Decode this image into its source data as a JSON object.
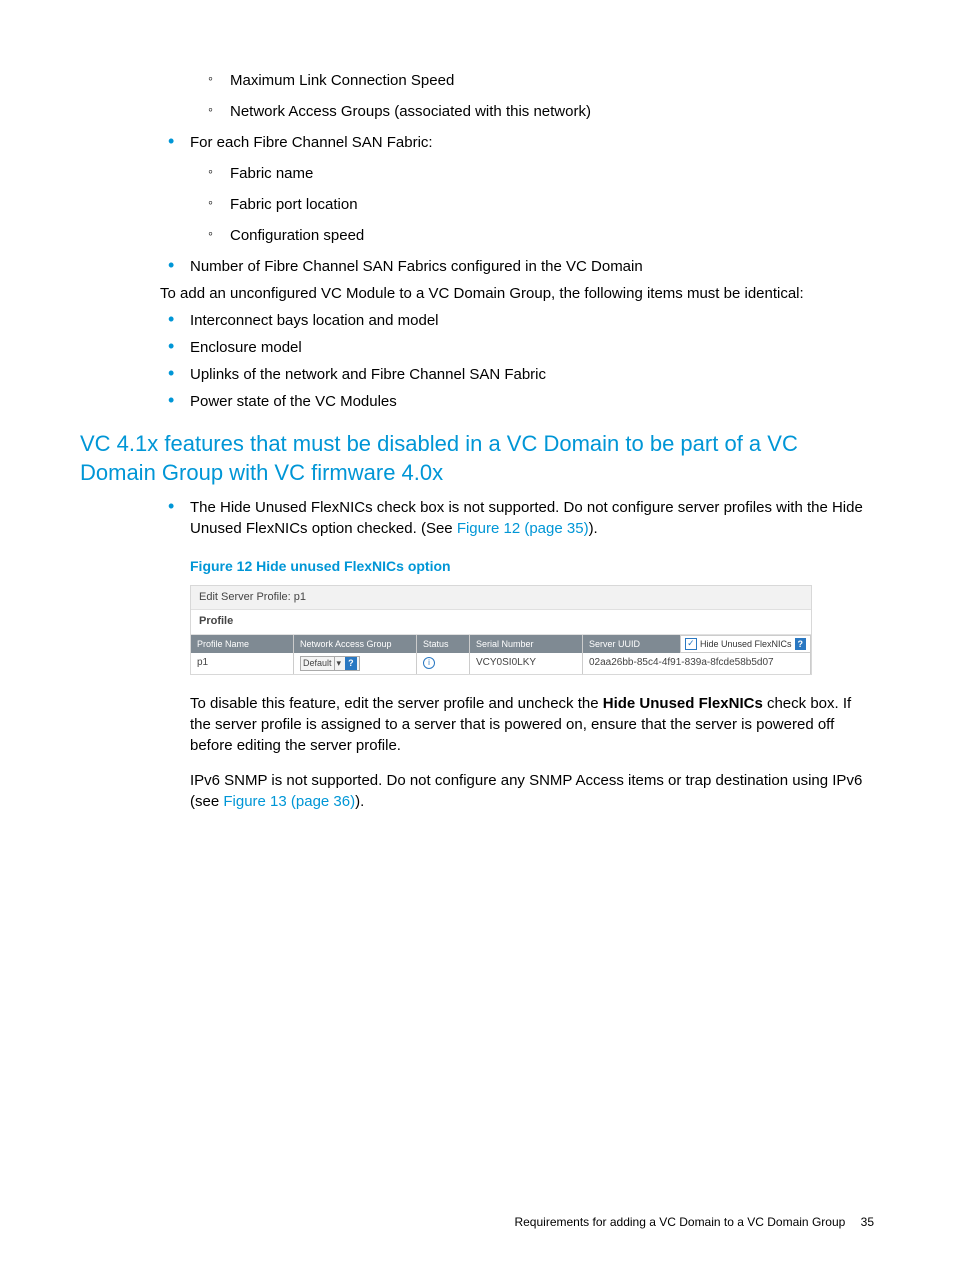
{
  "list_top_sub": {
    "a": "Maximum Link Connection Speed",
    "b": "Network Access Groups (associated with this network)"
  },
  "fc_intro": "For each Fibre Channel SAN Fabric:",
  "fc_sub": {
    "a": "Fabric name",
    "b": "Fabric port location",
    "c": "Configuration speed"
  },
  "fc_num": "Number of Fibre Channel SAN Fabrics configured in the VC Domain",
  "para_add": "To add an unconfigured VC Module to a VC Domain Group, the following items must be identical:",
  "ident": {
    "a": "Interconnect bays location and model",
    "b": "Enclosure model",
    "c": "Uplinks of the network and Fibre Channel SAN Fabric",
    "d": "Power state of the VC Modules"
  },
  "section_heading": "VC 4.1x features that must be disabled in a VC Domain to be part of a VC Domain Group with VC firmware 4.0x",
  "flexnic_para_a": "The Hide Unused FlexNICs check box is not supported. Do not configure server profiles with the Hide Unused FlexNICs option checked. (See ",
  "flexnic_link": "Figure 12 (page 35)",
  "flexnic_para_b": ").",
  "figure_caption": "Figure 12 Hide unused FlexNICs option",
  "fig12": {
    "edit_label": "Edit Server Profile:",
    "edit_value": "p1",
    "profile_tab": "Profile",
    "hdr": {
      "name": "Profile Name",
      "nag": "Network Access Group",
      "status": "Status",
      "sn": "Serial Number",
      "uuid": "Server UUID"
    },
    "row": {
      "name": "p1",
      "nag": "Default",
      "sn": "VCY0SI0LKY",
      "uuid": "02aa26bb-85c4-4f91-839a-8fcde58b5d07"
    },
    "hide_label": "Hide Unused FlexNICs"
  },
  "disable_a": "To disable this feature, edit the server profile and uncheck the ",
  "disable_bold": "Hide Unused FlexNICs",
  "disable_b": " check box. If the server profile is assigned to a server that is powered on, ensure that the server is powered off before editing the server profile.",
  "ipv6_a": "IPv6 SNMP is not supported. Do not configure any SNMP Access items or trap destination using IPv6 (see ",
  "ipv6_link": "Figure 13 (page 36)",
  "ipv6_b": ").",
  "footer_text": "Requirements for adding a VC Domain to a VC Domain Group",
  "footer_page": "35"
}
